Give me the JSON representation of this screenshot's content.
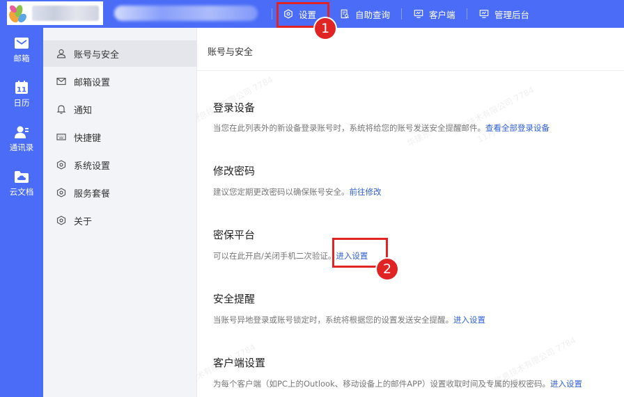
{
  "topbar": {
    "items": [
      {
        "label": "设置",
        "icon": "settings-hex-icon"
      },
      {
        "label": "自助查询",
        "icon": "self-query-icon"
      },
      {
        "label": "客户端",
        "icon": "monitor-icon"
      },
      {
        "label": "管理后台",
        "icon": "admin-monitor-icon"
      }
    ]
  },
  "leftnav": {
    "items": [
      {
        "label": "邮箱",
        "icon": "mail-icon"
      },
      {
        "label": "日历",
        "icon": "calendar-icon",
        "day": "11"
      },
      {
        "label": "通讯录",
        "icon": "contacts-icon"
      },
      {
        "label": "云文档",
        "icon": "cloud-folder-icon"
      }
    ]
  },
  "menu": {
    "items": [
      {
        "label": "账号与安全",
        "icon": "user-icon",
        "active": true
      },
      {
        "label": "邮箱设置",
        "icon": "envelope-icon"
      },
      {
        "label": "通知",
        "icon": "bell-icon"
      },
      {
        "label": "快捷键",
        "icon": "keyboard-icon"
      },
      {
        "label": "系统设置",
        "icon": "hexagon-gear-icon"
      },
      {
        "label": "服务套餐",
        "icon": "hexagon-gear-icon"
      },
      {
        "label": "关于",
        "icon": "hexagon-gear-icon"
      }
    ]
  },
  "content": {
    "title": "账号与安全",
    "sections": [
      {
        "title": "登录设备",
        "desc": "当您在此列表外的新设备登录账号时，系统将给您的账号发送安全提醒邮件。",
        "link": "查看全部登录设备"
      },
      {
        "title": "修改密码",
        "desc": "建议您定期更改密码以确保账号安全。",
        "link": "前往修改"
      },
      {
        "title": "密保平台",
        "desc": "可以在此开启/关闭手机二次验证。",
        "link": "进入设置"
      },
      {
        "title": "安全提醒",
        "desc": "当账号异地登录或账号锁定时，系统将根据您的设置发送安全提醒。",
        "link": "进入设置"
      },
      {
        "title": "客户端设置",
        "desc": "为每个客户端（如PC上的Outlook、移动设备上的邮件APP）设置收取时间及专属的授权密码。",
        "link": "进入设置"
      }
    ]
  },
  "annotations": {
    "badge1": "1",
    "badge2": "2",
    "color": "#e02424"
  },
  "watermark": [
    "上海",
    "信息技术有限公司 7784",
    "11月11日",
    "华建东"
  ]
}
